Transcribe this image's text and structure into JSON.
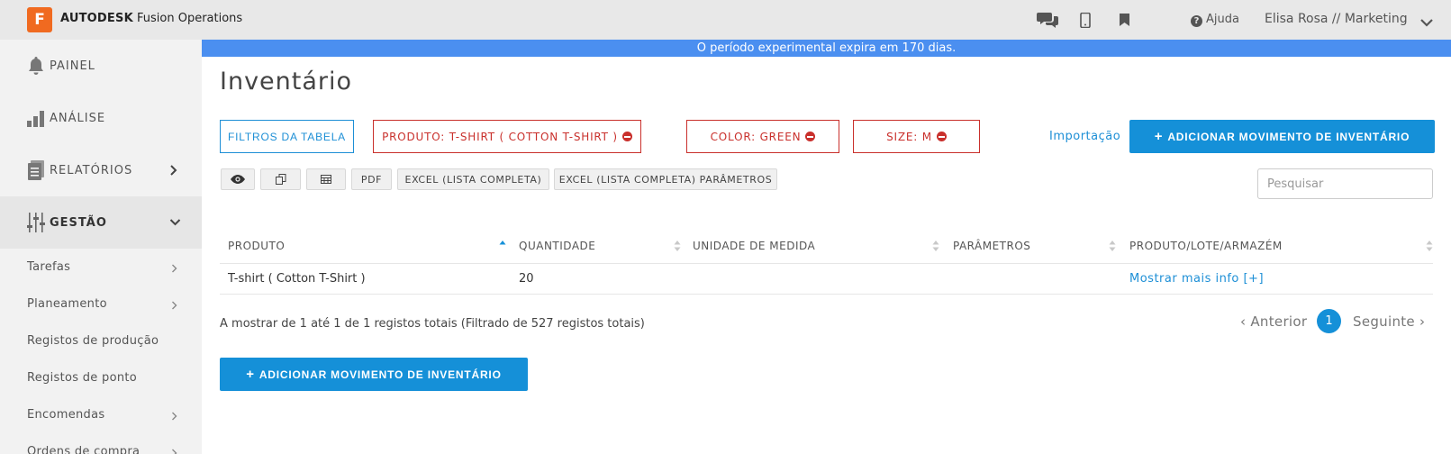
{
  "app": {
    "logo_letter": "F",
    "brand": "AUTODESK",
    "product": "Fusion Operations"
  },
  "topbar": {
    "help_label": "Ajuda",
    "user_label": "Elisa Rosa // Marketing",
    "icons": [
      "chat-icon",
      "mobile-icon",
      "bookmark-icon",
      "help-icon",
      "chevron-down-icon"
    ]
  },
  "banner": {
    "text": "O período experimental expira em 170 dias."
  },
  "sidebar": {
    "main": [
      {
        "label": "PAINEL",
        "icon": "bell-icon"
      },
      {
        "label": "ANÁLISE",
        "icon": "bar-chart-icon"
      },
      {
        "label": "RELATÓRIOS",
        "icon": "document-icon"
      },
      {
        "label": "GESTÃO",
        "icon": "sliders-icon",
        "active": true
      }
    ],
    "sub": [
      {
        "label": "Tarefas",
        "has_chevron": true
      },
      {
        "label": "Planeamento",
        "has_chevron": true
      },
      {
        "label": "Registos de produção",
        "has_chevron": false
      },
      {
        "label": "Registos de ponto",
        "has_chevron": false
      },
      {
        "label": "Encomendas",
        "has_chevron": true
      },
      {
        "label": "Ordens de compra",
        "has_chevron": true
      }
    ]
  },
  "page": {
    "title": "Inventário",
    "filter_button": "FILTROS DA TABELA",
    "active_filters": [
      "PRODUTO: T-SHIRT ( COTTON T-SHIRT )",
      "COLOR: GREEN",
      "SIZE: M"
    ],
    "import_link": "Importação",
    "add_button": "ADICIONAR MOVIMENTO DE INVENTÁRIO",
    "toolbar": {
      "pdf": "PDF",
      "excel": "EXCEL (LISTA COMPLETA)",
      "excel_params": "EXCEL (LISTA COMPLETA) PARÂMETROS"
    },
    "search_placeholder": "Pesquisar"
  },
  "table": {
    "columns": [
      "PRODUTO",
      "QUANTIDADE",
      "UNIDADE DE MEDIDA",
      "PARÂMETROS",
      "PRODUTO/LOTE/ARMAZÉM"
    ],
    "rows": [
      {
        "produto": "T-shirt ( Cotton T-Shirt )",
        "quantidade": "20",
        "unidade": "",
        "parametros": "",
        "link": "Mostrar mais info [+]"
      }
    ]
  },
  "pagination": {
    "info": "A mostrar de 1 até 1 de 1 registos totais (Filtrado de 527 registos totais)",
    "prev": "Anterior",
    "current": "1",
    "next": "Seguinte"
  },
  "colors": {
    "accent": "#1590d8",
    "filter_red": "#c9302c",
    "banner": "#4b8ff0",
    "logo": "#f06a20"
  }
}
